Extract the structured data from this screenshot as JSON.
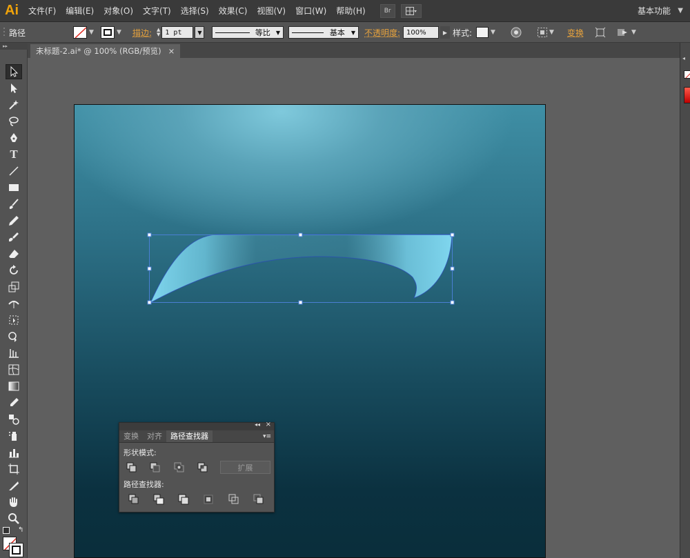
{
  "app": {
    "logo": "Ai"
  },
  "menu": {
    "items": [
      "文件(F)",
      "编辑(E)",
      "对象(O)",
      "文字(T)",
      "选择(S)",
      "效果(C)",
      "视图(V)",
      "窗口(W)",
      "帮助(H)"
    ],
    "bridge_label": "Br",
    "workspace": "基本功能"
  },
  "control": {
    "selection_type": "路径",
    "stroke_label": "描边:",
    "stroke_weight": "1 pt",
    "stroke_profile": "等比",
    "brush": "基本",
    "opacity_label": "不透明度:",
    "opacity_value": "100%",
    "style_label": "样式:",
    "transform_label": "变换"
  },
  "document": {
    "tab_title": "未标题-2.ai* @ 100% (RGB/预览)",
    "close_glyph": "×"
  },
  "pathfinder_panel": {
    "tabs": [
      "变换",
      "对齐",
      "路径查找器"
    ],
    "active_tab": 2,
    "shape_modes_label": "形状模式:",
    "pathfinders_label": "路径查找器:",
    "expand_label": "扩展"
  },
  "colors": {
    "accent_orange": "#e8a33d",
    "selection_blue": "#4a7fd4",
    "shape_light": "#7fd6ee"
  }
}
